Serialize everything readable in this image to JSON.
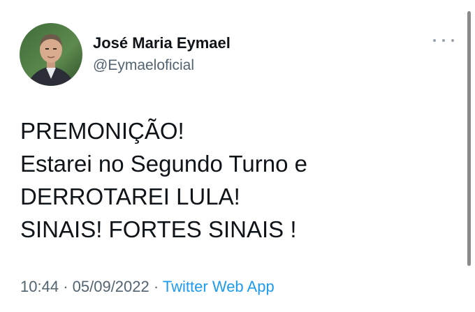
{
  "user": {
    "name": "José Maria Eymael",
    "handle": "@Eymaeloficial"
  },
  "tweet": {
    "lines": [
      "PREMONIÇÃO!",
      "Estarei no Segundo Turno e",
      "DERROTAREI LULA!",
      "SINAIS! FORTES SINAIS !"
    ],
    "time": "10:44",
    "separator1": "·",
    "date": "05/09/2022",
    "separator2": "·",
    "source": "Twitter Web App"
  },
  "icons": {
    "more": "more-options-icon"
  },
  "colors": {
    "text": "#0f1419",
    "secondary": "#536471",
    "link": "#1d9bf0"
  }
}
